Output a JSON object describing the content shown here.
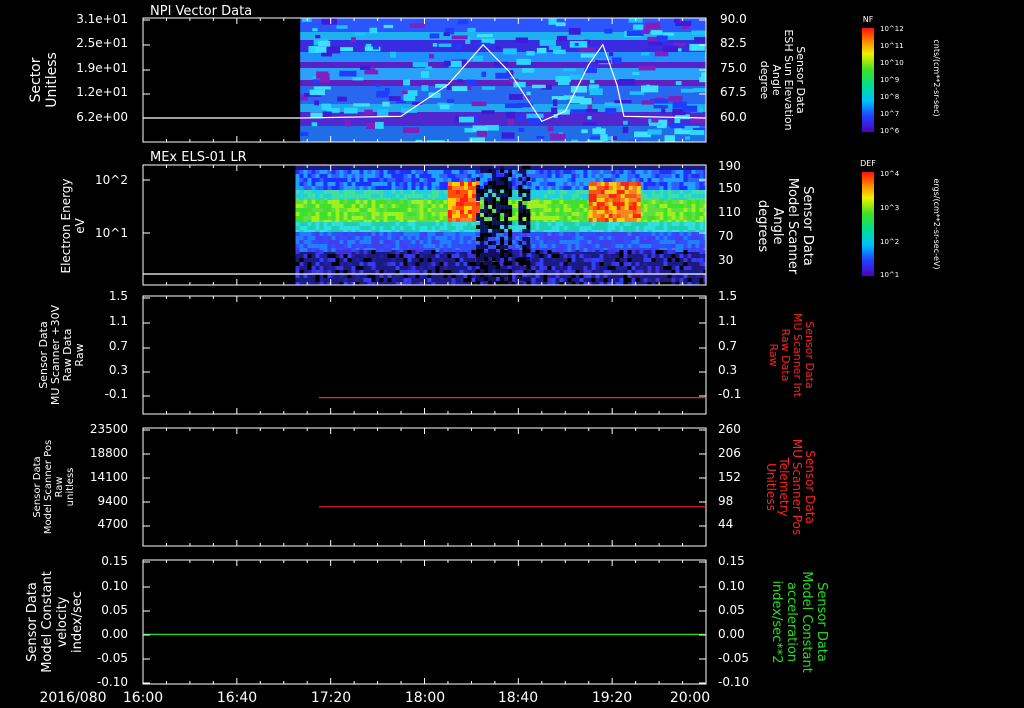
{
  "date_label": "2016/080",
  "time_ticks": [
    "16:00",
    "16:40",
    "17:20",
    "18:00",
    "18:40",
    "19:20",
    "20:00"
  ],
  "colors": {
    "white": "#ffffff",
    "red": "#ff2020",
    "green": "#20e020",
    "axis": "#ffffff"
  },
  "chart_data": [
    {
      "type": "heatmap",
      "title": "NPI Vector Data",
      "ylabel_left": [
        "Sector",
        "Unitless"
      ],
      "yticks_left": [
        "3.1e+01",
        "2.5e+01",
        "1.9e+01",
        "1.2e+01",
        "6.2e+00"
      ],
      "ylabel_right": [
        "Sensor Data",
        "ESH Sun Elevation",
        "Angle",
        "degree"
      ],
      "yticks_right": [
        "90.0",
        "82.5",
        "75.0",
        "67.5",
        "60.0"
      ],
      "colorbar": {
        "label": "NF",
        "unit": "cnts/(cm**2-sr-sec)",
        "ticks": [
          "10^12",
          "10^11",
          "10^10",
          "10^9",
          "10^8",
          "10^7",
          "10^6"
        ]
      },
      "x_range": [
        "16:00",
        "20:00"
      ],
      "data_start": "17:07",
      "overlay_line": {
        "name": "ESH Sun Elevation Angle",
        "x": [
          "16:00",
          "17:07",
          "17:50",
          "18:10",
          "18:25",
          "18:36",
          "18:50",
          "19:00",
          "19:10",
          "19:16",
          "19:22",
          "19:25",
          "20:00"
        ],
        "y": [
          60.0,
          60.0,
          60.5,
          70.0,
          82.0,
          74.0,
          59.0,
          62.0,
          76.0,
          82.0,
          70.0,
          60.5,
          60.0
        ]
      }
    },
    {
      "type": "heatmap",
      "title": "MEx ELS-01 LR",
      "ylabel_left": [
        "Electron Energy",
        "eV"
      ],
      "yticks_left": [
        "10^2",
        "10^1"
      ],
      "ylabel_right": [
        "Sensor Data",
        "Model Scanner",
        "Angle",
        "degrees"
      ],
      "yticks_right": [
        "190",
        "150",
        "110",
        "70",
        "30"
      ],
      "colorbar": {
        "label": "DEF",
        "unit": "ergs/(cm**2-sr-sec-eV)",
        "ticks": [
          "10^4",
          "10^3",
          "10^2",
          "10^1"
        ]
      },
      "x_range": [
        "16:00",
        "20:00"
      ],
      "data_start": "17:05",
      "overlay_line": {
        "name": "Model Scanner Angle",
        "x": [
          "16:00",
          "20:00"
        ],
        "y": [
          20,
          20
        ]
      }
    },
    {
      "type": "line",
      "ylabel_left": [
        "Sensor Data",
        "MU Scanner +30V",
        "Raw Data",
        "Raw"
      ],
      "yticks_left": [
        "1.5",
        "1.1",
        "0.7",
        "0.3",
        "-0.1"
      ],
      "ylabel_right": [
        "Sensor Data",
        "MU Scanner Int",
        "Raw Data",
        "Raw"
      ],
      "yticks_right": [
        "1.5",
        "1.1",
        "0.7",
        "0.3",
        "-0.1"
      ],
      "ylim": [
        -0.3,
        1.5
      ],
      "series": [
        {
          "x": [
            "17:15",
            "20:00"
          ],
          "y": [
            -0.05,
            -0.05
          ],
          "color": "red"
        }
      ]
    },
    {
      "type": "line",
      "ylabel_left": [
        "Sensor Data",
        "Model Scanner Pos",
        "Raw",
        "unitless"
      ],
      "yticks_left": [
        "23500",
        "18800",
        "14100",
        "9400",
        "4700"
      ],
      "ylabel_right": [
        "Sensor Data",
        "MU Scanner Pos",
        "Telemetry",
        "Unitless"
      ],
      "yticks_right": [
        "260",
        "206",
        "152",
        "98",
        "44"
      ],
      "ylim": [
        0,
        23500
      ],
      "series": [
        {
          "x": [
            "17:15",
            "20:00"
          ],
          "y": [
            7800,
            7800
          ],
          "color": "red"
        }
      ]
    },
    {
      "type": "line",
      "ylabel_left": [
        "Sensor Data",
        "Model Constant",
        "velocity",
        "index/sec"
      ],
      "yticks_left": [
        "0.15",
        "0.10",
        "0.05",
        "0.00",
        "-0.05",
        "-0.10"
      ],
      "ylabel_right": [
        "Sensor Data",
        "Model Constant",
        "acceleration",
        "index/sec**2"
      ],
      "yticks_right": [
        "0.15",
        "0.10",
        "0.05",
        "0.00",
        "-0.05",
        "-0.10"
      ],
      "ylim": [
        -0.1,
        0.15
      ],
      "series": [
        {
          "x": [
            "16:00",
            "20:00"
          ],
          "y": [
            0.0,
            0.0
          ],
          "color": "green"
        }
      ]
    }
  ]
}
